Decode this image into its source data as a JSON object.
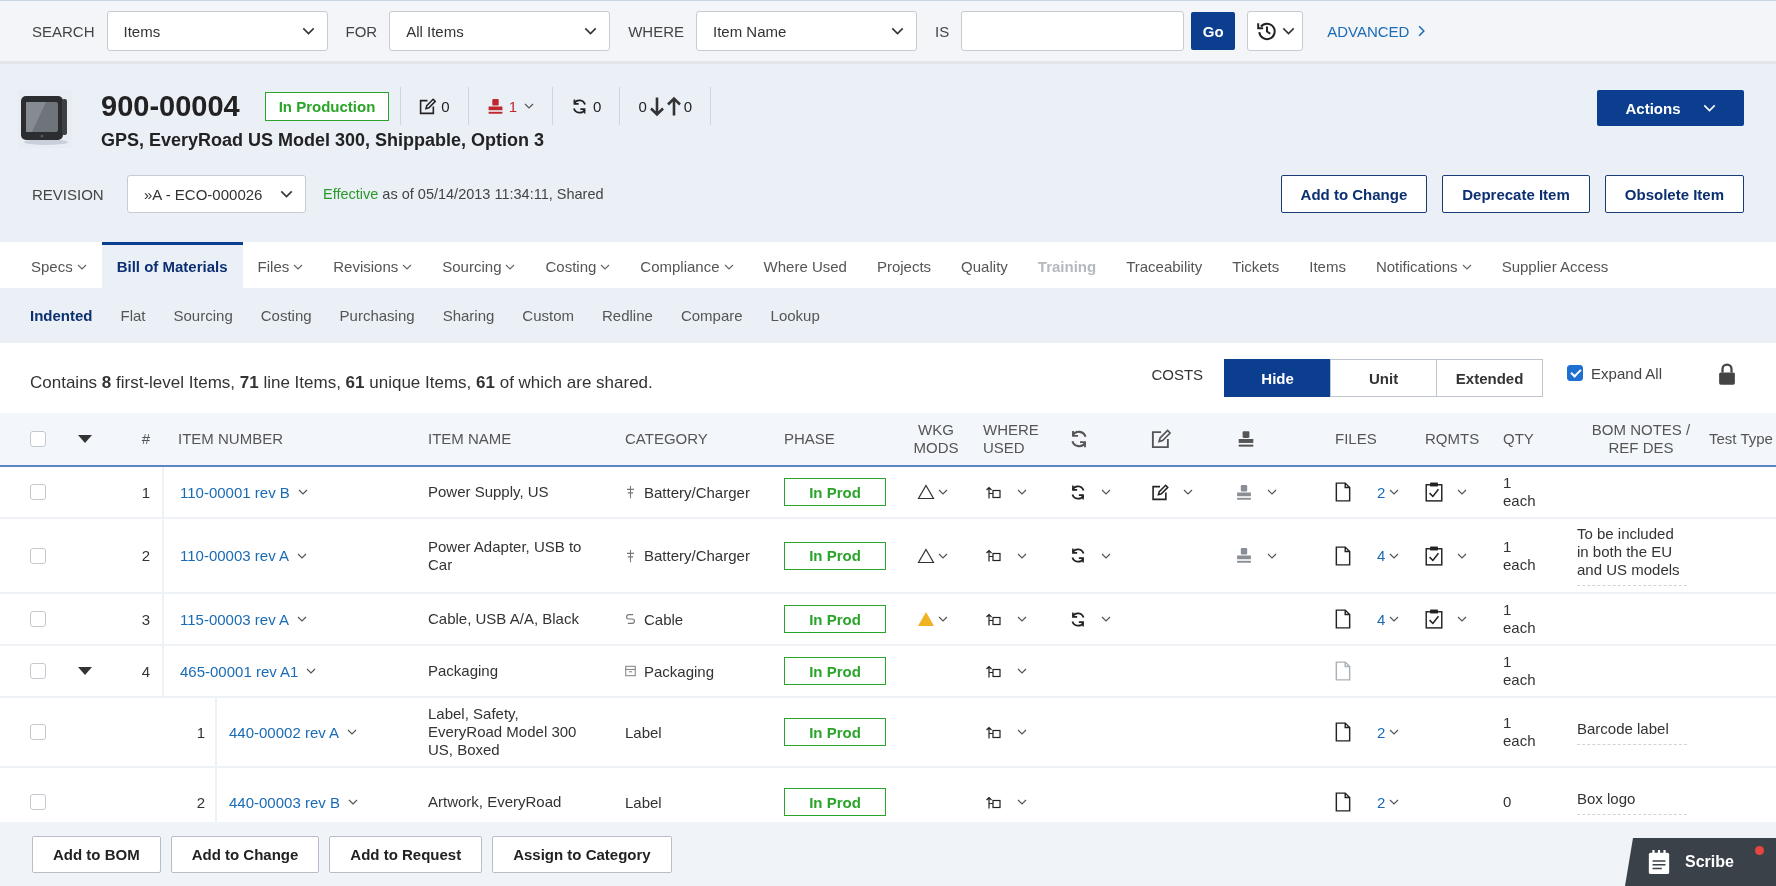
{
  "search_bar": {
    "search_label": "SEARCH",
    "search_in": "Items",
    "for_label": "FOR",
    "for_value": "All Items",
    "where_label": "WHERE",
    "where_value": "Item Name",
    "is_label": "IS",
    "go": "Go",
    "advanced": "ADVANCED"
  },
  "item": {
    "number": "900-00004",
    "lifecycle": "In Production",
    "description": "GPS, EveryRoad US Model 300, Shippable, Option 3",
    "counters": [
      {
        "kind": "changes",
        "value": "0",
        "menu": false,
        "alert": false
      },
      {
        "kind": "stamp",
        "value": "1",
        "menu": true,
        "alert": true
      },
      {
        "kind": "revisions",
        "value": "0",
        "menu": false,
        "alert": false
      }
    ],
    "transfers": {
      "down": "0",
      "up": "0"
    },
    "actions": "Actions",
    "revision_label": "REVISION",
    "revision": "»A - ECO-000026",
    "effective_status": "Effective",
    "effective_text": "as of 05/14/2013 11:34:11, Shared",
    "buttons": [
      "Add to Change",
      "Deprecate Item",
      "Obsolete Item"
    ]
  },
  "tabs": [
    {
      "label": "Specs",
      "menu": true,
      "selected": false,
      "disabled": false
    },
    {
      "label": "Bill of Materials",
      "menu": false,
      "selected": true,
      "disabled": false
    },
    {
      "label": "Files",
      "menu": true,
      "selected": false,
      "disabled": false
    },
    {
      "label": "Revisions",
      "menu": true,
      "selected": false,
      "disabled": false
    },
    {
      "label": "Sourcing",
      "menu": true,
      "selected": false,
      "disabled": false
    },
    {
      "label": "Costing",
      "menu": true,
      "selected": false,
      "disabled": false
    },
    {
      "label": "Compliance",
      "menu": true,
      "selected": false,
      "disabled": false
    },
    {
      "label": "Where Used",
      "menu": false,
      "selected": false,
      "disabled": false
    },
    {
      "label": "Projects",
      "menu": false,
      "selected": false,
      "disabled": false
    },
    {
      "label": "Quality",
      "menu": false,
      "selected": false,
      "disabled": false
    },
    {
      "label": "Training",
      "menu": false,
      "selected": false,
      "disabled": true
    },
    {
      "label": "Traceability",
      "menu": false,
      "selected": false,
      "disabled": false
    },
    {
      "label": "Tickets",
      "menu": false,
      "selected": false,
      "disabled": false
    },
    {
      "label": "Items",
      "menu": false,
      "selected": false,
      "disabled": false
    },
    {
      "label": "Notifications",
      "menu": true,
      "selected": false,
      "disabled": false
    },
    {
      "label": "Supplier Access",
      "menu": false,
      "selected": false,
      "disabled": false
    }
  ],
  "subtabs": [
    {
      "label": "Indented",
      "selected": true
    },
    {
      "label": "Flat",
      "selected": false
    },
    {
      "label": "Sourcing",
      "selected": false
    },
    {
      "label": "Costing",
      "selected": false
    },
    {
      "label": "Purchasing",
      "selected": false
    },
    {
      "label": "Sharing",
      "selected": false
    },
    {
      "label": "Custom",
      "selected": false
    },
    {
      "label": "Redline",
      "selected": false
    },
    {
      "label": "Compare",
      "selected": false
    },
    {
      "label": "Lookup",
      "selected": false
    }
  ],
  "summary": "Contains **8** first-level Items, **71** line Items, **61** unique Items, **61** of which are shared.",
  "costs": {
    "label": "COSTS",
    "options": [
      {
        "label": "Hide",
        "selected": true
      },
      {
        "label": "Unit",
        "selected": false
      },
      {
        "label": "Extended",
        "selected": false
      }
    ]
  },
  "expand_all": {
    "label": "Expand All",
    "checked": true
  },
  "locked": true,
  "table": {
    "columns": {
      "number": "#",
      "item_number": "ITEM NUMBER",
      "item_name": "ITEM NAME",
      "category": "CATEGORY",
      "phase": "PHASE",
      "wkg_mods": "WKG MODS",
      "where_used": "WHERE USED",
      "files": "FILES",
      "rqmts": "RQMTS",
      "qty": "QTY",
      "bom_notes": "BOM NOTES / REF DES",
      "test_type": "Test Type"
    },
    "all_checked": false,
    "all_expanded": true,
    "rows": [
      {
        "checked": false,
        "number": "1",
        "item_number": "110-00001 rev B",
        "item_name": "Power Supply, US",
        "category": {
          "kind": "battery",
          "text": "Battery/Charger"
        },
        "phase": "In Prod",
        "wkg_mods": {
          "kind": "outline"
        },
        "revisions": true,
        "changes": true,
        "stamp": true,
        "files": {
          "count": "2",
          "empty": false
        },
        "rqmts": true,
        "qty": "1",
        "unit": "each"
      },
      {
        "checked": false,
        "number": "2",
        "item_number": "110-00003 rev A",
        "item_name": "Power Adapter, USB to Car",
        "category": {
          "kind": "battery",
          "text": "Battery/Charger"
        },
        "phase": "In Prod",
        "wkg_mods": {
          "kind": "outline"
        },
        "revisions": true,
        "changes": false,
        "stamp": true,
        "files": {
          "count": "4",
          "empty": false
        },
        "rqmts": true,
        "qty": "1",
        "unit": "each",
        "notes": "To be included in both the EU and US models"
      },
      {
        "checked": false,
        "number": "3",
        "item_number": "115-00003 rev A",
        "item_name": "Cable, USB A/A, Black",
        "category": {
          "kind": "cable",
          "text": "Cable"
        },
        "phase": "In Prod",
        "wkg_mods": {
          "kind": "warning"
        },
        "revisions": true,
        "changes": false,
        "stamp": false,
        "files": {
          "count": "4",
          "empty": false
        },
        "rqmts": true,
        "qty": "1",
        "unit": "each"
      },
      {
        "checked": false,
        "expanded": true,
        "number": "4",
        "item_number": "465-00001 rev A1",
        "item_name": "Packaging",
        "category": {
          "kind": "packaging",
          "text": "Packaging"
        },
        "phase": "In Prod",
        "revisions": false,
        "changes": false,
        "stamp": false,
        "files": {
          "empty": true
        },
        "rqmts": false,
        "qty": "1",
        "unit": "each",
        "children": [
          {
            "checked": false,
            "number": "1",
            "item_number": "440-00002 rev A",
            "item_name": "Label, Safety, EveryRoad Model 300 US, Boxed",
            "category": {
              "text": "Label"
            },
            "phase": "In Prod",
            "revisions": false,
            "changes": false,
            "stamp": false,
            "files": {
              "count": "2",
              "empty": false
            },
            "rqmts": false,
            "qty": "1",
            "unit": "each",
            "notes": "Barcode label"
          },
          {
            "checked": false,
            "number": "2",
            "item_number": "440-00003 rev B",
            "item_name": "Artwork, EveryRoad",
            "category": {
              "text": "Label"
            },
            "phase": "In Prod",
            "revisions": false,
            "changes": false,
            "stamp": false,
            "files": {
              "count": "2",
              "empty": false
            },
            "rqmts": false,
            "qty": "0",
            "notes": "Box logo"
          }
        ]
      }
    ]
  },
  "bottom_buttons": [
    "Add to BOM",
    "Add to Change",
    "Add to Request",
    "Assign to Category"
  ],
  "scribe": {
    "label": "Scribe",
    "notification": true
  }
}
